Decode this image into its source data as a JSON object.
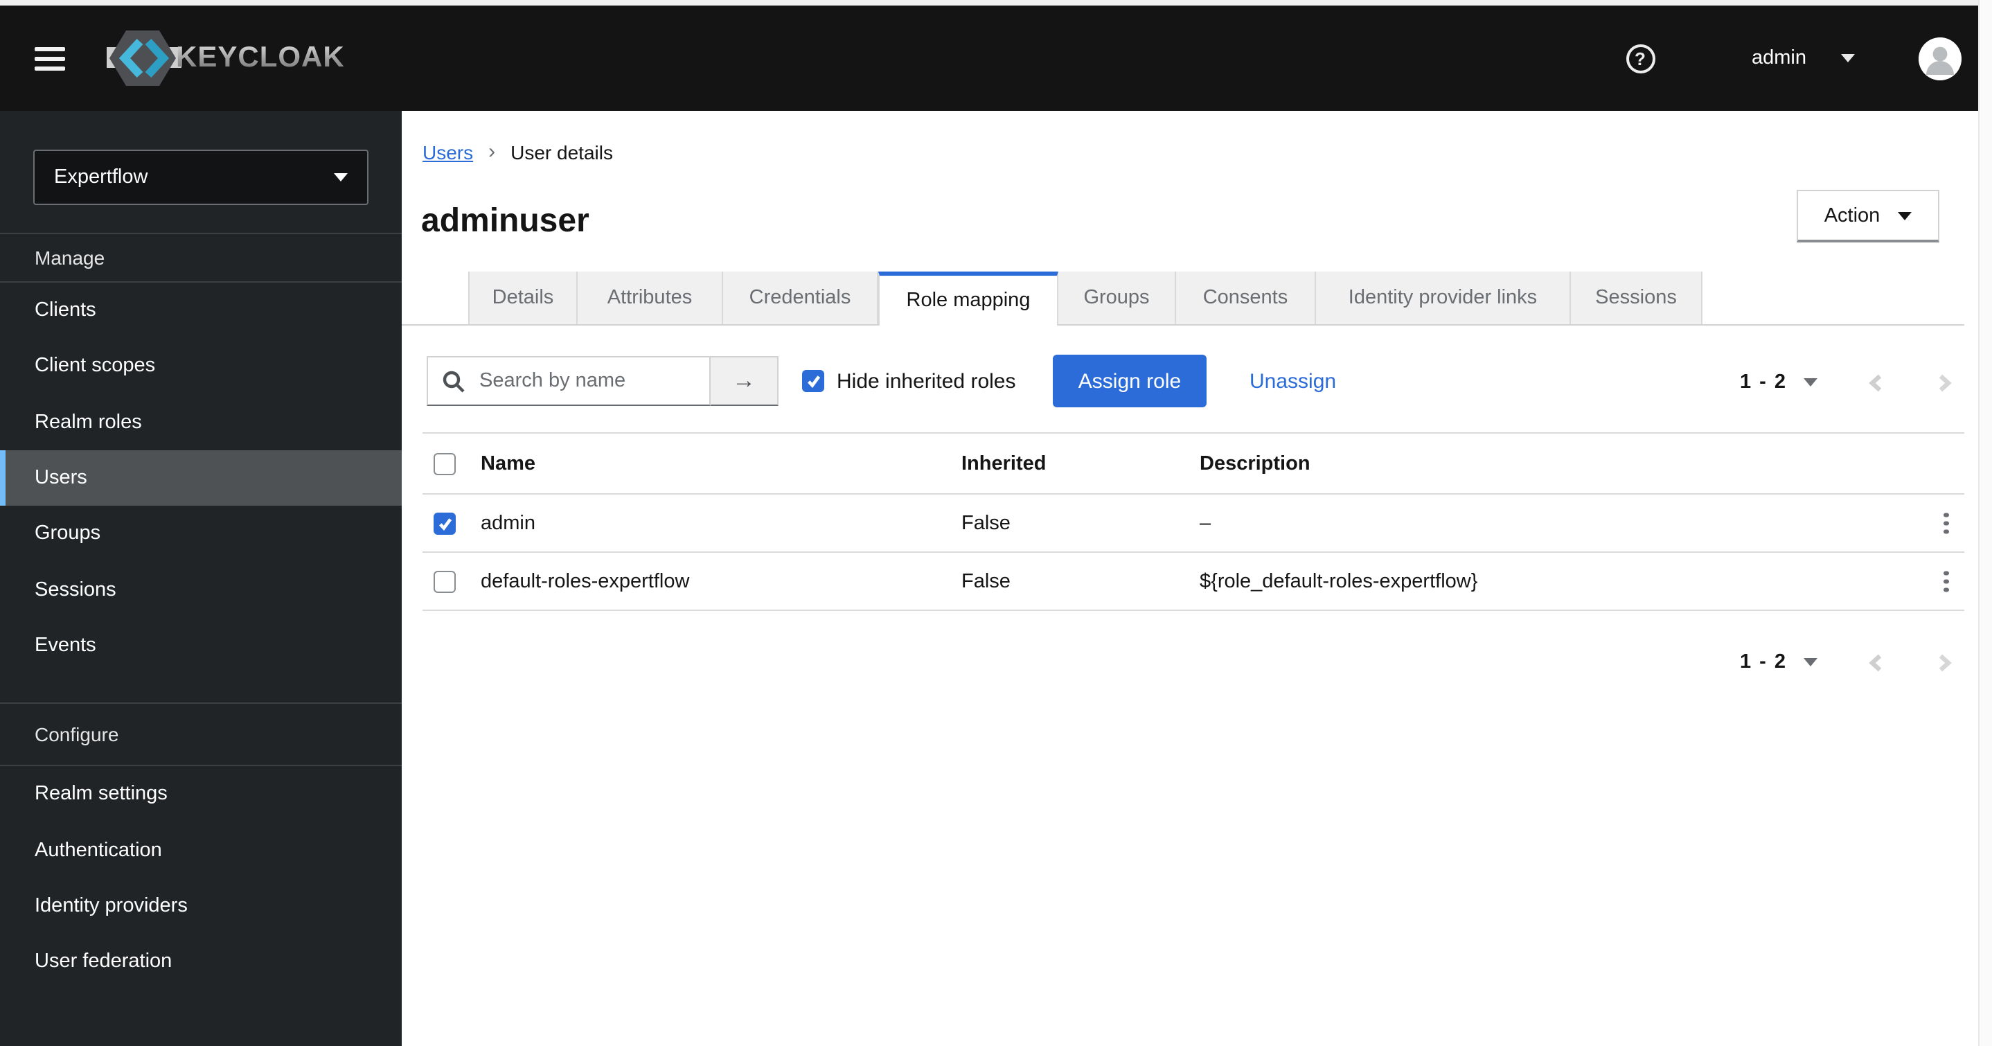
{
  "masthead": {
    "brand": "KEYCLOAK",
    "user": "admin"
  },
  "sidebar": {
    "realm": "Expertflow",
    "sections": [
      {
        "label": "Manage",
        "items": [
          {
            "label": "Clients"
          },
          {
            "label": "Client scopes"
          },
          {
            "label": "Realm roles"
          },
          {
            "label": "Users"
          },
          {
            "label": "Groups"
          },
          {
            "label": "Sessions"
          },
          {
            "label": "Events"
          }
        ],
        "active_item": "Users"
      },
      {
        "label": "Configure",
        "items": [
          {
            "label": "Realm settings"
          },
          {
            "label": "Authentication"
          },
          {
            "label": "Identity providers"
          },
          {
            "label": "User federation"
          }
        ]
      }
    ]
  },
  "breadcrumb": {
    "link": "Users",
    "current": "User details"
  },
  "page": {
    "title": "adminuser",
    "action_label": "Action"
  },
  "tabs": {
    "active": "Role mapping",
    "items": [
      {
        "label": "Details"
      },
      {
        "label": "Attributes"
      },
      {
        "label": "Credentials"
      },
      {
        "label": "Role mapping"
      },
      {
        "label": "Groups"
      },
      {
        "label": "Consents"
      },
      {
        "label": "Identity provider links"
      },
      {
        "label": "Sessions"
      }
    ]
  },
  "toolbar": {
    "search_placeholder": "Search by name",
    "hide_inherited_label": "Hide inherited roles",
    "hide_inherited_checked": true,
    "assign_label": "Assign role",
    "unassign_label": "Unassign"
  },
  "pagination": {
    "range": "1 - 2"
  },
  "table": {
    "columns": [
      "Name",
      "Inherited",
      "Description"
    ],
    "rows": [
      {
        "checked": true,
        "name": "admin",
        "inherited": "False",
        "description": "–"
      },
      {
        "checked": false,
        "name": "default-roles-expertflow",
        "inherited": "False",
        "description": "${role_default-roles-expertflow}"
      }
    ]
  },
  "icons": {
    "breadcrumb_separator": "›",
    "search_submit_arrow": "→",
    "help_glyph": "?"
  },
  "colors": {
    "primary_blue": "#2b6cd8",
    "nav_accent_blue": "#73bcf7",
    "masthead_bg": "#141414",
    "sidebar_bg": "#212427",
    "nav_active_bg": "#4f5255",
    "tab_bg": "#f0f0f0",
    "border": "#d2d2d2",
    "text": "#151515",
    "muted_text": "#6a6e73"
  }
}
